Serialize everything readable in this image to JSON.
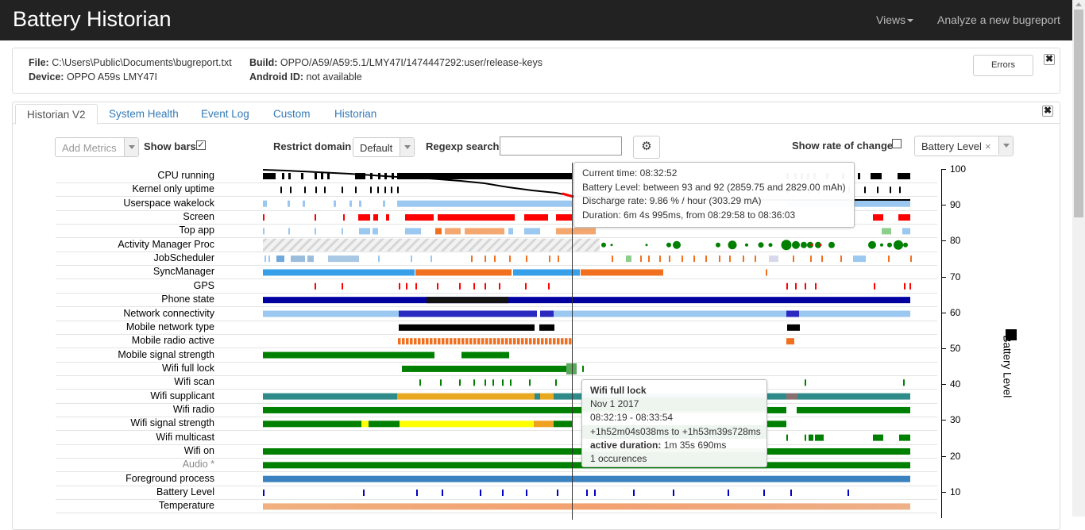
{
  "app": {
    "title": "Battery Historian",
    "nav": {
      "views": "Views",
      "analyze": "Analyze a new bugreport"
    }
  },
  "file_info": {
    "file_label": "File:",
    "file_value": "C:\\Users\\Public\\Documents\\bugreport.txt",
    "device_label": "Device:",
    "device_value": "OPPO A59s LMY47I",
    "build_label": "Build:",
    "build_value": "OPPO/A59/A59:5.1/LMY47I/1474447292:user/release-keys",
    "android_id_label": "Android ID:",
    "android_id_value": "not available",
    "errors_button": "Errors",
    "close_glyph": "✖"
  },
  "tabs": [
    "Historian V2",
    "System Health",
    "Event Log",
    "Custom",
    "Historian"
  ],
  "controls": {
    "add_metrics_placeholder": "Add Metrics",
    "show_bars_label": "Show bars",
    "show_bars_checked": true,
    "restrict_domain_label": "Restrict domain",
    "domain_value": "Default",
    "regexp_label": "Regexp search",
    "regexp_value": "",
    "show_rate_label": "Show rate of change",
    "show_rate_checked": false,
    "metric_value": "Battery Level",
    "metric_clear": "×"
  },
  "rows": [
    "CPU running",
    "Kernel only uptime",
    "Userspace wakelock",
    "Screen",
    "Top app",
    "Activity Manager Proc",
    "JobScheduler",
    "SyncManager",
    "GPS",
    "Phone state",
    "Network connectivity",
    "Mobile network type",
    "Mobile radio active",
    "Mobile signal strength",
    "Wifi full lock",
    "Wifi scan",
    "Wifi supplicant",
    "Wifi radio",
    "Wifi signal strength",
    "Wifi multicast",
    "Wifi on",
    "Audio *",
    "Foreground process",
    "Battery Level",
    "Temperature"
  ],
  "y_axis": {
    "title": "Battery Level",
    "ticks": [
      "100",
      "90",
      "80",
      "70",
      "60",
      "50",
      "40",
      "30",
      "20",
      "10"
    ],
    "range": [
      0,
      100
    ]
  },
  "colors": {
    "accent": "#337ab7",
    "battery_line": "#000000",
    "screen": "#ff0000",
    "green": "#008000",
    "dark_blue": "#0000a0",
    "light_blue": "#9ac8f0",
    "orange": "#f07020",
    "teal": "#2f8a8a",
    "yellow": "#ffff00"
  },
  "tooltip_battery": {
    "current_time": "Current time: 08:32:52",
    "battery_level": "Battery Level: between 93 and 92 (2859.75 and 2829.00 mAh)",
    "discharge_rate": "Discharge rate: 9.86 % / hour (303.29 mA)",
    "duration": "Duration: 6m 4s 995ms, from 08:29:58 to 08:36:03"
  },
  "tooltip_wifi": {
    "title": "Wifi full lock",
    "date": "Nov 1 2017",
    "time_range": "08:32:19 - 08:33:54",
    "offset_range": "+1h52m04s038ms to +1h53m39s728ms",
    "active_label": "active duration:",
    "active_value": "1m 35s 690ms",
    "occurrences": "1 occurences"
  }
}
